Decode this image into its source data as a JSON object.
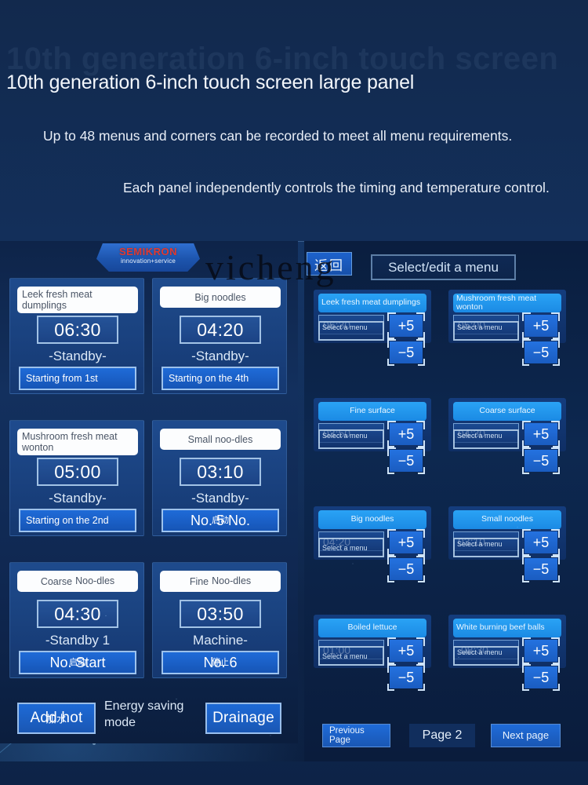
{
  "marketing": {
    "ghost_heading": "10th generation 6-inch touch screen",
    "headline": "10th generation 6-inch touch screen large panel",
    "sub1": "Up to 48 menus and corners can be recorded to meet all menu requirements.",
    "sub2": "Each panel independently controls the timing and temperature control."
  },
  "watermark": "vicheng",
  "left_panel": {
    "brand": {
      "name": "SEMIKRON",
      "tagline": "innovation+service"
    },
    "tiles": [
      {
        "name": "Leek fresh meat dumplings",
        "name_align": "left",
        "time": "06:30",
        "status": "-Standby-",
        "action": "Starting from 1st",
        "action_cn": ""
      },
      {
        "name": "Big noodles",
        "name_align": "center",
        "time": "04:20",
        "status": "-Standby-",
        "action": "Starting on the 4th",
        "action_cn": ""
      },
      {
        "name": "Mushroom fresh meat wonton",
        "name_align": "left",
        "time": "05:00",
        "status": "-Standby-",
        "action": "Starting on the 2nd",
        "action_cn": ""
      },
      {
        "name": "Small noo-dles",
        "name_align": "center",
        "time": "03:10",
        "status": "-Standby-",
        "action": "No. 5 No.",
        "action_cn": "启动"
      },
      {
        "name": "Coarse",
        "name_suffix": "Noo-dles",
        "name_align": "center",
        "time": "04:30",
        "status": "-Standby 1",
        "action": "No. Start",
        "action_cn": "启动"
      },
      {
        "name": "Fine",
        "name_suffix": "Noo-dles",
        "name_align": "center",
        "time": "03:50",
        "status": "Machine-",
        "action": "No. 6",
        "action_cn": "停止"
      }
    ],
    "bottom": {
      "add_hot": "Add hot",
      "add_hot_cn": "加水",
      "eco_mode": "Energy saving mode",
      "drainage": "Drainage"
    }
  },
  "right_panel": {
    "back_button": "返回",
    "select_edit": "Select/edit a menu",
    "step_up": "+5",
    "step_down": "−5",
    "select_placeholder": "Select a menu",
    "menus": [
      {
        "name": "Leek fresh meat dumplings",
        "align": "left",
        "time": "06:30",
        "select": "Select a menu"
      },
      {
        "name": "Mushroom fresh meat wonton",
        "align": "left",
        "time": "05:00",
        "select": "Select a menu"
      },
      {
        "name": "Fine surface",
        "align": "center",
        "time": "03:50",
        "select": "Select a menu"
      },
      {
        "name": "Coarse surface",
        "align": "center",
        "time": "04:30",
        "select": "Select a menu"
      },
      {
        "name": "Big noodles",
        "align": "center",
        "time": "04:20",
        "select": "Select a menu"
      },
      {
        "name": "Small noodles",
        "align": "center",
        "time": "03:10",
        "select": "Select a menu"
      },
      {
        "name": "Boiled lettuce",
        "align": "center",
        "time": "01:00",
        "select": "Select a menu"
      },
      {
        "name": "White burning beef balls",
        "align": "left",
        "time": ".08:30",
        "select": "Select a menu"
      }
    ],
    "pager": {
      "previous": "Previous Page",
      "page_label": "Page 2",
      "next": "Next page"
    }
  },
  "colors": {
    "page_bg": "#12294d",
    "panel_blue": "#13305e",
    "accent_blue": "#1f6bd8",
    "menu_header": "#2aa3f5",
    "brand_red": "#e2392f",
    "text_light": "#eaf3fd"
  }
}
